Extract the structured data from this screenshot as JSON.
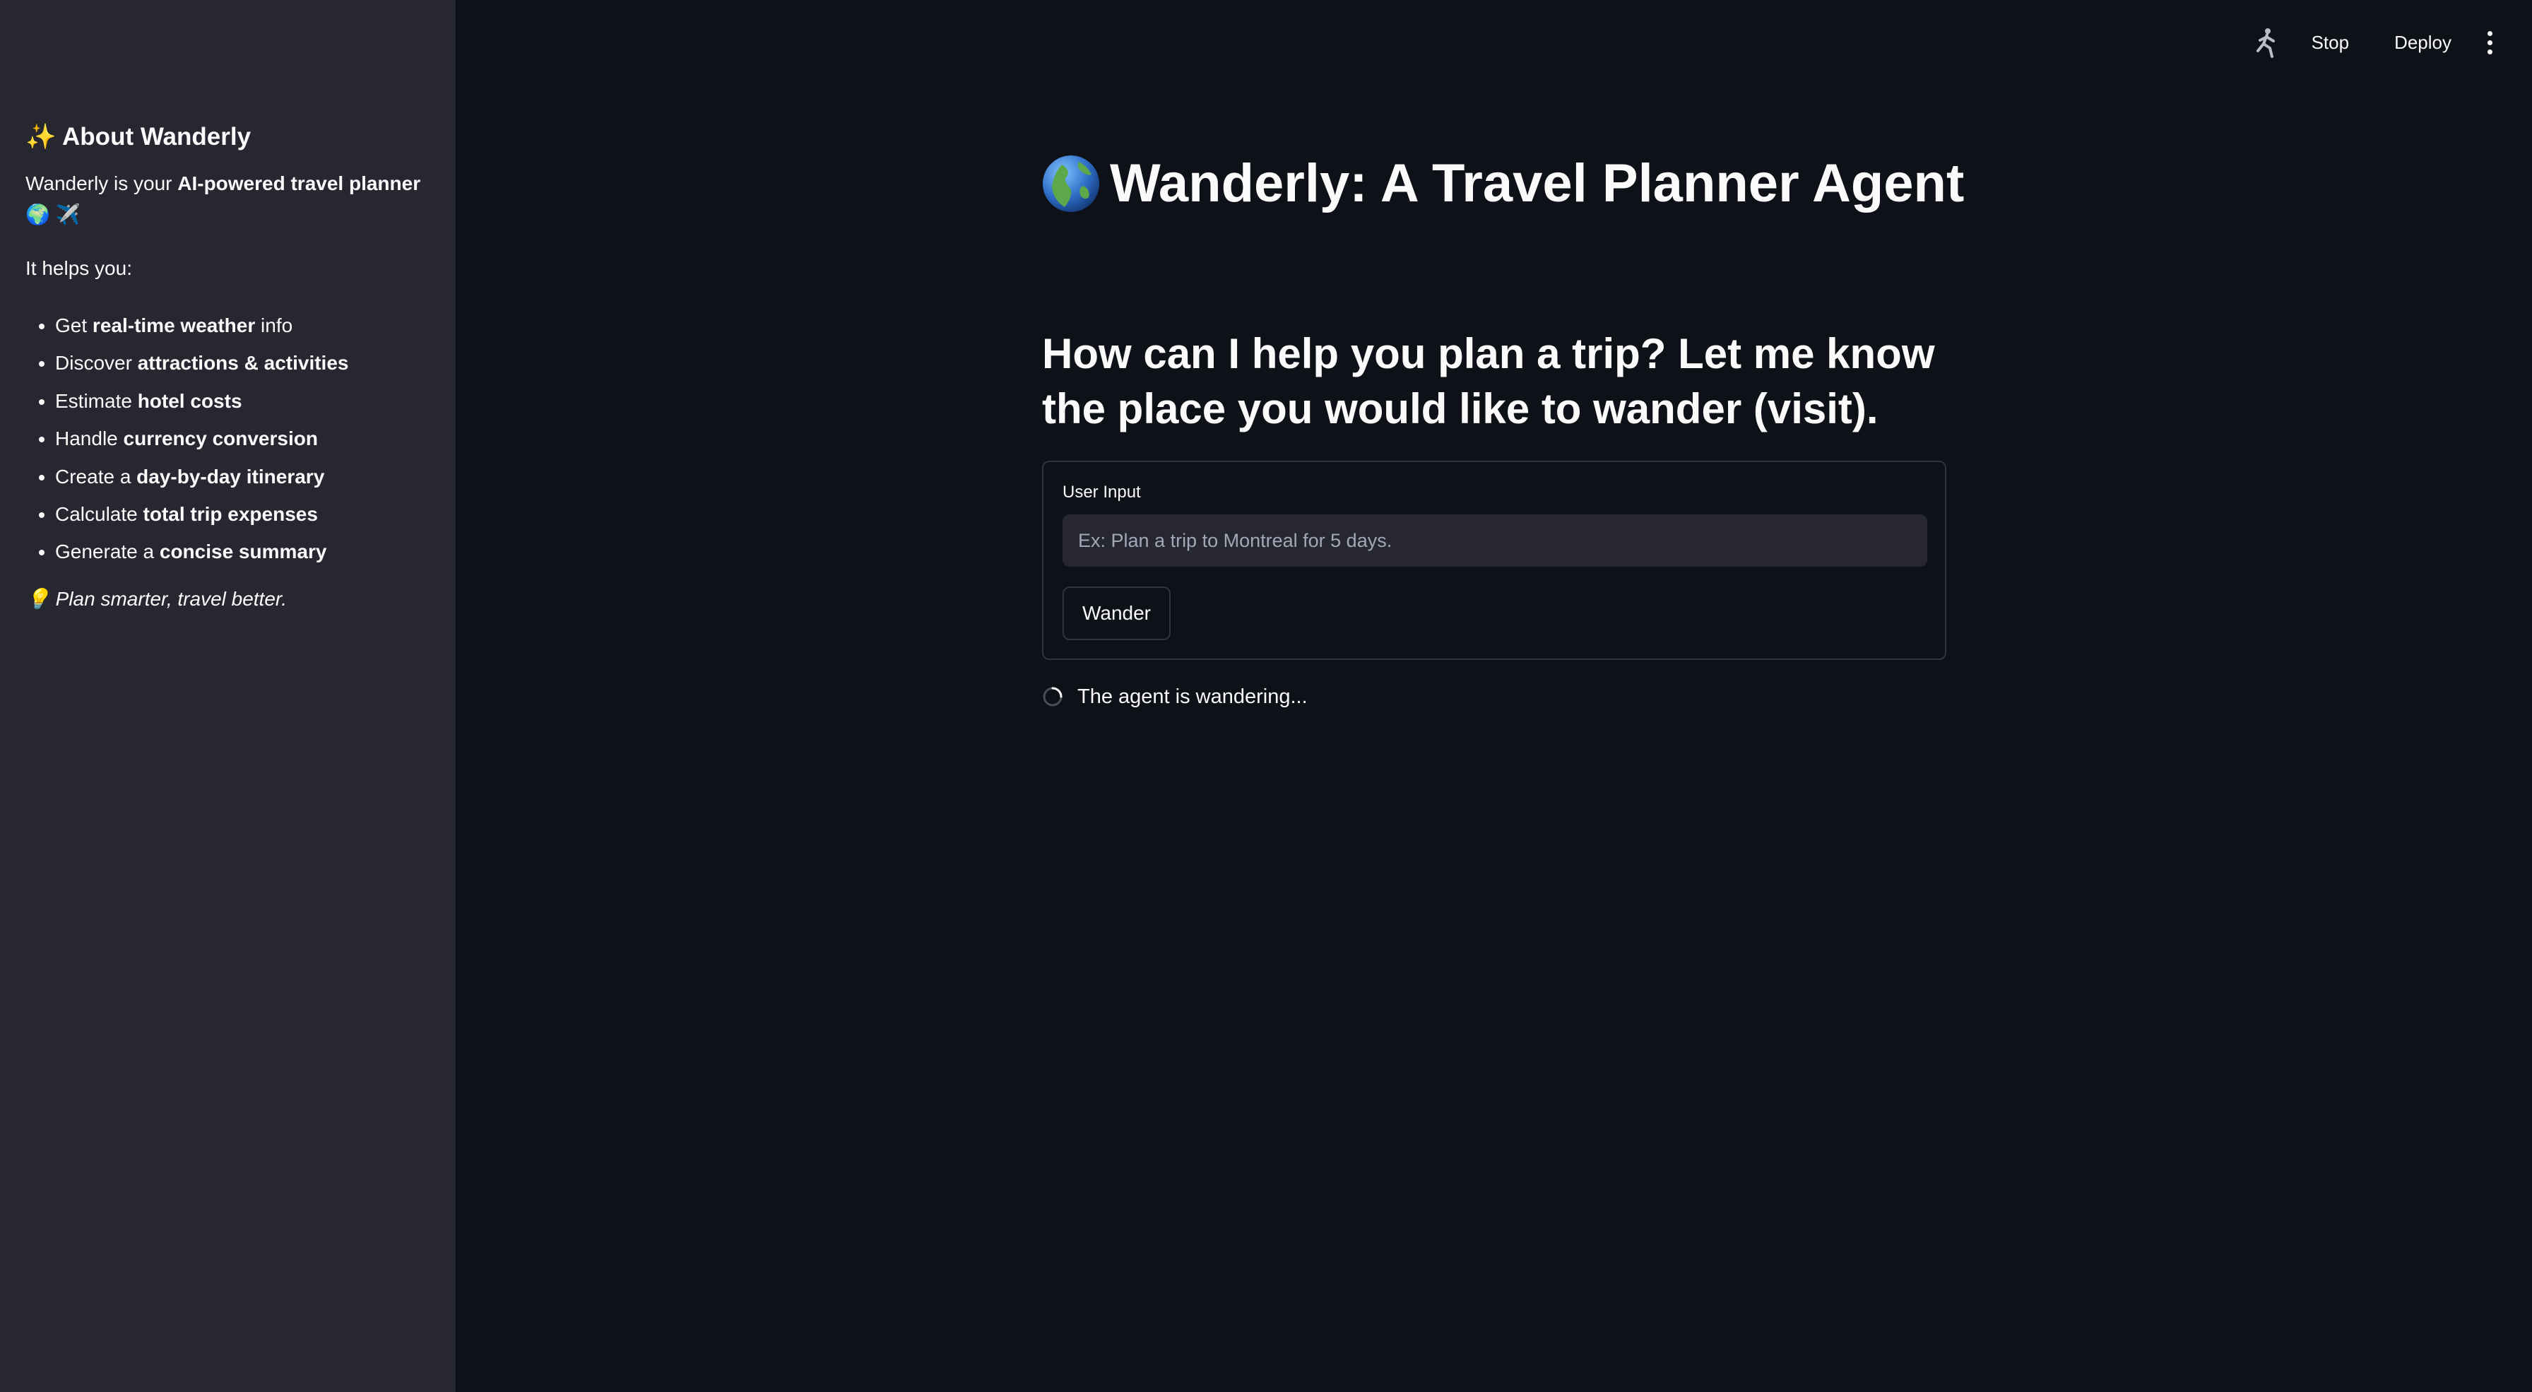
{
  "sidebar": {
    "title_emoji": "✨",
    "title": "About Wanderly",
    "intro_prefix": "Wanderly is your ",
    "intro_bold": "AI-powered travel planner",
    "intro_emoji": "🌍 ✈️",
    "helps": "It helps you:",
    "items": [
      {
        "prefix": "Get ",
        "bold": "real-time weather",
        "suffix": " info"
      },
      {
        "prefix": "Discover ",
        "bold": "attractions & activities",
        "suffix": ""
      },
      {
        "prefix": "Estimate ",
        "bold": "hotel costs",
        "suffix": ""
      },
      {
        "prefix": "Handle ",
        "bold": "currency conversion",
        "suffix": ""
      },
      {
        "prefix": "Create a ",
        "bold": "day-by-day itinerary",
        "suffix": ""
      },
      {
        "prefix": "Calculate ",
        "bold": "total trip expenses",
        "suffix": ""
      },
      {
        "prefix": "Generate a ",
        "bold": "concise summary",
        "suffix": ""
      }
    ],
    "tagline_emoji": "💡",
    "tagline": "Plan smarter, travel better."
  },
  "toolbar": {
    "running_icon": "running-man-icon",
    "stop_label": "Stop",
    "deploy_label": "Deploy",
    "menu_icon": "vertical-dots-icon"
  },
  "main": {
    "title": "Wanderly: A Travel Planner Agent",
    "title_icon": "globe-icon",
    "subheading": "How can I help you plan a trip? Let me know the place you would like to wander (visit).",
    "form": {
      "label": "User Input",
      "value": "",
      "placeholder": "Ex: Plan a trip to Montreal for 5 days.",
      "button_label": "Wander"
    },
    "status_text": "The agent is wandering..."
  },
  "colors": {
    "background": "#0e1117",
    "sidebar": "#262730",
    "input": "#262730",
    "border": "#31333f",
    "text": "#fafafa"
  }
}
